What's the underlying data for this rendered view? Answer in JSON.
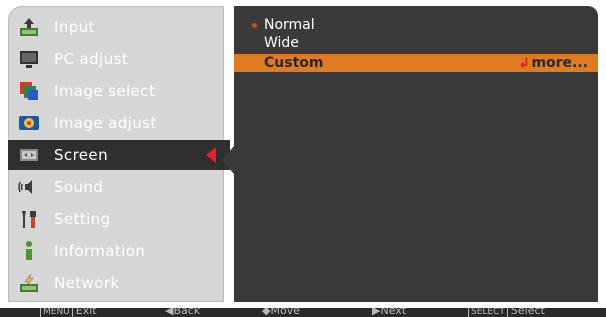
{
  "menu": {
    "items": [
      {
        "label": "Input",
        "icon": "input-icon"
      },
      {
        "label": "PC adjust",
        "icon": "pc-adjust-icon"
      },
      {
        "label": "Image select",
        "icon": "image-select-icon"
      },
      {
        "label": "Image adjust",
        "icon": "image-adjust-icon"
      },
      {
        "label": "Screen",
        "icon": "screen-icon",
        "selected": true
      },
      {
        "label": "Sound",
        "icon": "sound-icon"
      },
      {
        "label": "Setting",
        "icon": "setting-icon"
      },
      {
        "label": "Information",
        "icon": "information-icon"
      },
      {
        "label": "Network",
        "icon": "network-icon"
      }
    ]
  },
  "screen_options": {
    "items": [
      {
        "label": "Normal",
        "current": true
      },
      {
        "label": "Wide"
      },
      {
        "label": "Custom",
        "highlighted": true,
        "more": "more..."
      }
    ]
  },
  "hints": {
    "exit_key": "MENU",
    "exit": "Exit",
    "back": "Back",
    "move": "Move",
    "next": "Next",
    "select_key": "SELECT",
    "select": "Select"
  },
  "colors": {
    "left_panel": "#d6d6d6",
    "right_panel": "#3a3a3a",
    "selected_item": "#2f2f2f",
    "highlight": "#e07b22",
    "selector_arrow": "#e3202a"
  }
}
